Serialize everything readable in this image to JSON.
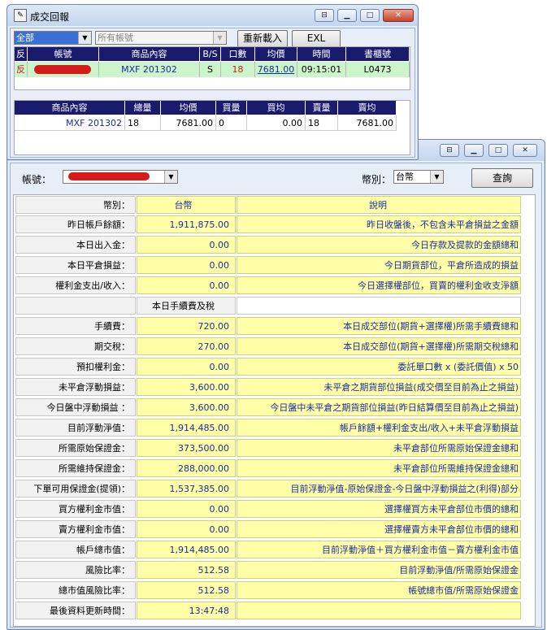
{
  "win1": {
    "title": "成交回報",
    "account_filter": "全部",
    "all_accounts": "所有帳號",
    "reload_label": "重新載入",
    "exl_label": "EXL",
    "trade_headers": [
      "反",
      "帳號",
      "商品內容",
      "B/S",
      "口數",
      "均價",
      "時間",
      "書櫃號"
    ],
    "trade_row": {
      "flag": "反",
      "product": "MXF 201302",
      "bs": "S",
      "qty": "18",
      "price": "7681.00",
      "time": "09:15:01",
      "book": "L0473"
    },
    "summary_headers": [
      "商品內容",
      "總量",
      "均價",
      "買量",
      "買均",
      "賣量",
      "賣均"
    ],
    "summary_row": {
      "product": "MXF 201302",
      "total": "18",
      "avg": "7681.00",
      "buy_qty": "0",
      "buy_avg": "0.00",
      "sell_qty": "18",
      "sell_avg": "7681.00"
    }
  },
  "win2": {
    "account_label": "帳號：",
    "currency_label": "幣別：",
    "currency_value": "台幣",
    "query_label": "查詢",
    "rows": [
      {
        "label": "幣別：",
        "value": "台幣",
        "desc": "說明"
      },
      {
        "label": "昨日帳戶餘額：",
        "value": "1,911,875.00",
        "desc": "昨日收盤後，不包含未平倉損益之金額"
      },
      {
        "label": "本日出入金：",
        "value": "0.00",
        "desc": "今日存款及提款的金額總和"
      },
      {
        "label": "本日平倉損益：",
        "value": "0.00",
        "desc": "今日期貨部位，平倉所造成的損益"
      },
      {
        "label": "權利金支出/收入：",
        "value": "0.00",
        "desc": "今日選擇權部位，買賣的權利金收支淨額"
      },
      {
        "label": "",
        "value": "本日手續費及稅",
        "desc": ""
      },
      {
        "label": "手續費：",
        "value": "720.00",
        "desc": "本日成交部位(期貨+選擇權)所需手續費總和"
      },
      {
        "label": "期交稅：",
        "value": "270.00",
        "desc": "本日成交部位(期貨+選擇權)所需期交稅總和"
      },
      {
        "label": "預扣權利金：",
        "value": "0.00",
        "desc": "委託單口數 x (委託價值) x 50"
      },
      {
        "label": "未平倉浮動損益：",
        "value": "3,600.00",
        "desc": "未平倉之期貨部位損益(成交價至目前為止之損益)"
      },
      {
        "label": "今日盤中浮動損益 ：",
        "value": "3,600.00",
        "desc": "今日盤中未平倉之期貨部位損益(昨日結算價至目前為止之損益)"
      },
      {
        "label": "目前浮動淨值：",
        "value": "1,914,485.00",
        "desc": "帳戶餘額+權利金支出/收入+未平倉浮動損益"
      },
      {
        "label": "所需原始保證金：",
        "value": "373,500.00",
        "desc": "未平倉部位所需原始保證金總和"
      },
      {
        "label": "所需維持保證金：",
        "value": "288,000.00",
        "desc": "未平倉部位所需維持保證金總和"
      },
      {
        "label": "下單可用保證金(提領)：",
        "value": "1,537,385.00",
        "desc": "目前浮動淨值-原始保證金-今日盤中浮動損益之(利得)部分"
      },
      {
        "label": "買方權利金市值：",
        "value": "0.00",
        "desc": "選擇權買方未平倉部位市價的總和"
      },
      {
        "label": "賣方權利金市值：",
        "value": "0.00",
        "desc": "選擇權賣方未平倉部位市價的總和"
      },
      {
        "label": "帳戶總市值：",
        "value": "1,914,485.00",
        "desc": "目前浮動淨值＋買方權利金市值－賣方權利金市值"
      },
      {
        "label": "風險比率：",
        "value": "512.58",
        "desc": "目前浮動淨值/所需原始保證金"
      },
      {
        "label": "總市值風險比率：",
        "value": "512.58",
        "desc": "帳號總市值/所需原始保證金"
      },
      {
        "label": "最後資料更新時間：",
        "value": "13:47:48",
        "desc": ""
      }
    ]
  },
  "colors": {
    "header_bg": "#1b1b6e",
    "row_green": "#ccf5cc",
    "yellow": "#ffffa8",
    "value_blue": "#1a2d9c",
    "flag_red": "#d61b1b"
  }
}
